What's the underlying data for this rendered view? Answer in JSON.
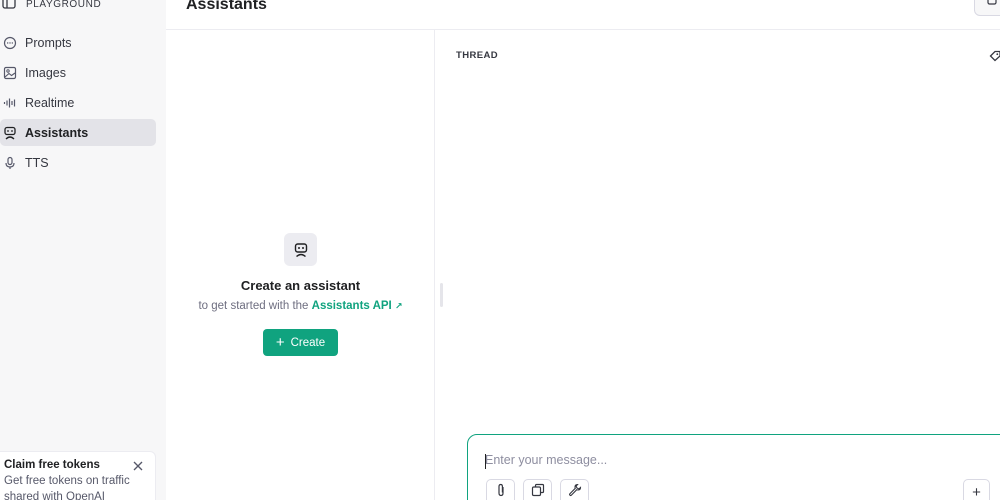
{
  "sidebar": {
    "brand": "PLAYGROUND",
    "items": [
      {
        "label": "Prompts",
        "icon": "chat-bubble-icon",
        "active": false
      },
      {
        "label": "Images",
        "icon": "image-icon",
        "active": false
      },
      {
        "label": "Realtime",
        "icon": "audio-wave-icon",
        "active": false
      },
      {
        "label": "Assistants",
        "icon": "robot-icon",
        "active": true
      },
      {
        "label": "TTS",
        "icon": "microphone-icon",
        "active": false
      }
    ],
    "promo": {
      "title": "Claim free tokens",
      "body": "Get free tokens on traffic shared with OpenAI"
    }
  },
  "header": {
    "title": "Assistants"
  },
  "empty_state": {
    "title": "Create an assistant",
    "subtitle_prefix": "to get started with the",
    "link": "Assistants API",
    "link_arrow": "↗",
    "button": "Create",
    "button_icon": "+"
  },
  "thread": {
    "label": "THREAD"
  },
  "composer": {
    "placeholder": "Enter your message...",
    "add_label": "+"
  },
  "colors": {
    "accent": "#10a37f",
    "sidebar_bg": "#f7f7f8",
    "active_item_bg": "#e3e3e8"
  }
}
